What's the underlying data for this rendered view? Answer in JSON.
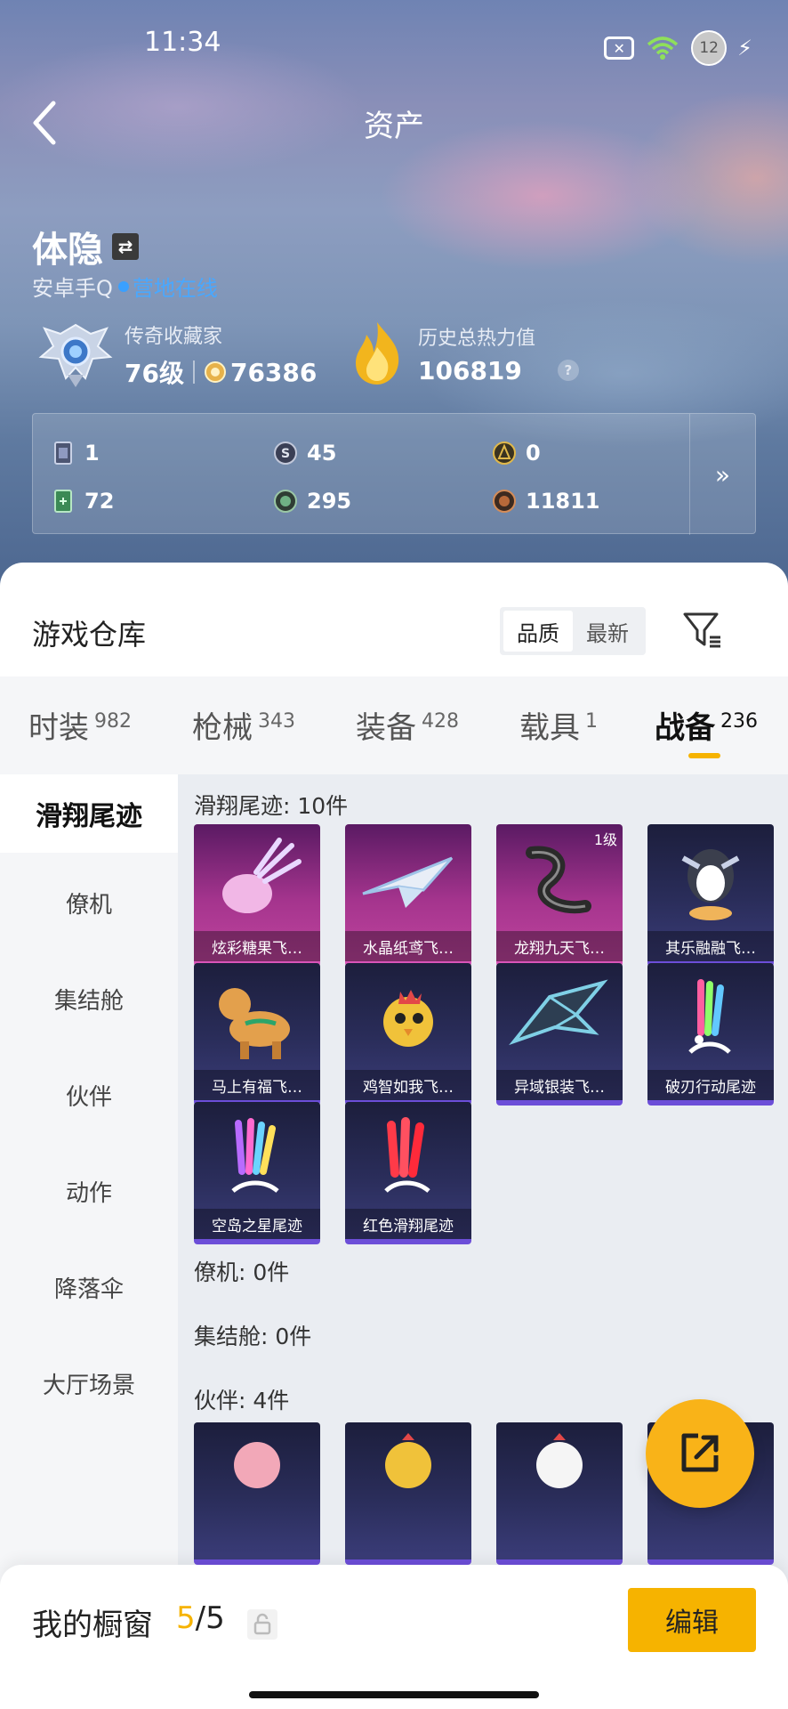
{
  "status_bar": {
    "time": "11:34",
    "battery": "12"
  },
  "header": {
    "title": "资产"
  },
  "user": {
    "name": "体隐",
    "platform": "安卓手Q",
    "online_status": "营地在线",
    "rank_title": "传奇收藏家",
    "level": "76级",
    "points": "76386",
    "heat_label": "历史总热力值",
    "heat_value": "106819",
    "heat_help": "?"
  },
  "currencies": [
    {
      "icon": "card-icon",
      "value": "1"
    },
    {
      "icon": "silver-coin-icon",
      "value": "45"
    },
    {
      "icon": "gold-medal-icon",
      "value": "0"
    },
    {
      "icon": "green-ticket-icon",
      "value": "72"
    },
    {
      "icon": "green-orb-icon",
      "value": "295"
    },
    {
      "icon": "bronze-coin-icon",
      "value": "11811"
    }
  ],
  "currency_more": "»",
  "warehouse": {
    "title": "游戏仓库",
    "sort_options": [
      "品质",
      "最新"
    ],
    "active_sort": "品质",
    "categories": [
      {
        "label": "时装",
        "count": "982"
      },
      {
        "label": "枪械",
        "count": "343"
      },
      {
        "label": "装备",
        "count": "428"
      },
      {
        "label": "载具",
        "count": "1"
      },
      {
        "label": "战备",
        "count": "236"
      }
    ],
    "active_category": "战备",
    "side_nav": [
      "滑翔尾迹",
      "僚机",
      "集结舱",
      "伙伴",
      "动作",
      "降落伞",
      "大厅场景"
    ],
    "sections": {
      "glide": "滑翔尾迹: 10件",
      "wingman": "僚机: 0件",
      "capsule": "集结舱: 0件",
      "partner": "伙伴: 4件"
    },
    "glide_items": [
      {
        "name": "炫彩糖果飞…",
        "rarity": "purple"
      },
      {
        "name": "水晶纸鸢飞…",
        "rarity": "purple"
      },
      {
        "name": "龙翔九天飞…",
        "rarity": "purple",
        "level": "1级"
      },
      {
        "name": "其乐融融飞…",
        "rarity": "blue"
      },
      {
        "name": "马上有福飞…",
        "rarity": "blue"
      },
      {
        "name": "鸡智如我飞…",
        "rarity": "blue"
      },
      {
        "name": "异域银装飞…",
        "rarity": "blue"
      },
      {
        "name": "破刃行动尾迹",
        "rarity": "blue"
      },
      {
        "name": "空岛之星尾迹",
        "rarity": "blue"
      },
      {
        "name": "红色滑翔尾迹",
        "rarity": "blue"
      }
    ]
  },
  "bottom_bar": {
    "label": "我的橱窗",
    "current": "5",
    "total": "/5",
    "edit_label": "编辑"
  },
  "colors": {
    "accent": "#f6b300",
    "online": "#3aa0ff",
    "purple_card": "#c0449e",
    "blue_card": "#3a3c78"
  }
}
